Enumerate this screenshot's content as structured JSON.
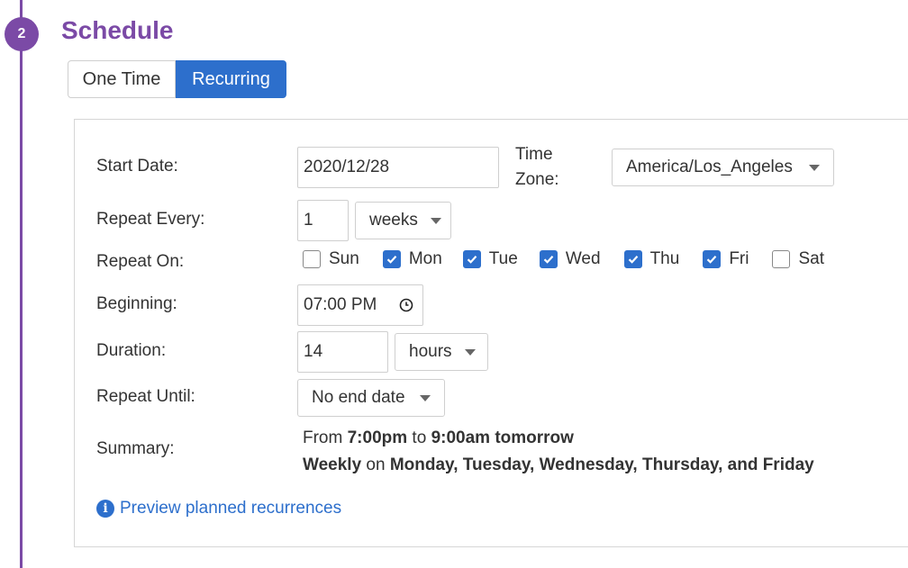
{
  "step": {
    "number": "2",
    "title": "Schedule"
  },
  "mode_toggle": {
    "one_time": "One Time",
    "recurring": "Recurring",
    "active": "recurring"
  },
  "form": {
    "start_date": {
      "label": "Start Date:",
      "value": "2020/12/28"
    },
    "time_zone": {
      "label_line1": "Time",
      "label_line2": "Zone:",
      "value": "America/Los_Angeles"
    },
    "repeat_every": {
      "label": "Repeat Every:",
      "value": "1",
      "unit": "weeks"
    },
    "repeat_on": {
      "label": "Repeat On:",
      "days": [
        {
          "label": "Sun",
          "checked": false
        },
        {
          "label": "Mon",
          "checked": true
        },
        {
          "label": "Tue",
          "checked": true
        },
        {
          "label": "Wed",
          "checked": true
        },
        {
          "label": "Thu",
          "checked": true
        },
        {
          "label": "Fri",
          "checked": true
        },
        {
          "label": "Sat",
          "checked": false
        }
      ]
    },
    "beginning": {
      "label": "Beginning:",
      "value": "07:00 PM"
    },
    "duration": {
      "label": "Duration:",
      "value": "14",
      "unit": "hours"
    },
    "repeat_until": {
      "label": "Repeat Until:",
      "value": "No end date"
    },
    "summary": {
      "label": "Summary:",
      "from_word": "From",
      "start": "7:00pm",
      "to_word": "to",
      "end": "9:00am tomorrow",
      "frequency": "Weekly",
      "on_word": "on",
      "days_text": "Monday, Tuesday, Wednesday, Thursday, and Friday"
    }
  },
  "preview_link": "Preview planned recurrences",
  "colors": {
    "accent_purple": "#7b4aa6",
    "primary_blue": "#2d6fcc"
  }
}
